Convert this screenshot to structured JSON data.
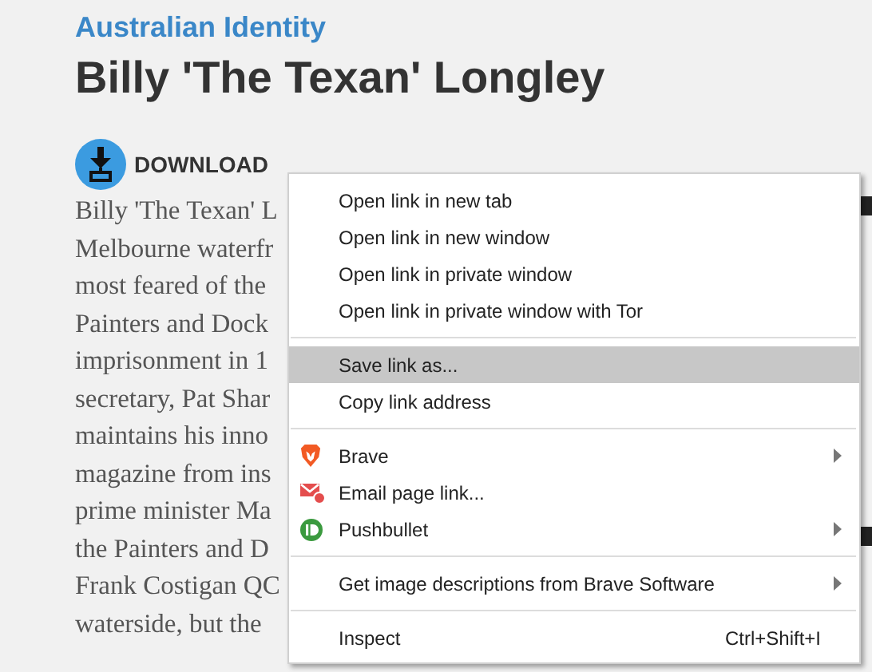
{
  "category": "Australian Identity",
  "title": "Billy 'The Texan' Longley",
  "download": {
    "label": "DOWNLOAD"
  },
  "article_lines": [
    "Billy 'The Texan' L",
    "Melbourne waterfr",
    "most feared of the",
    "Painters and Dock",
    "imprisonment in 1",
    "secretary, Pat Shar",
    "maintains his inno",
    "magazine from ins",
    "prime minister Ma",
    "the Painters and D",
    "Frank Costigan QC",
    "waterside, but the"
  ],
  "context_menu": [
    {
      "kind": "item",
      "label": "Open link in new tab",
      "submenu": false,
      "selected": false
    },
    {
      "kind": "item",
      "label": "Open link in new window",
      "submenu": false,
      "selected": false
    },
    {
      "kind": "item",
      "label": "Open link in private window",
      "submenu": false,
      "selected": false
    },
    {
      "kind": "item",
      "label": "Open link in private window with Tor",
      "submenu": false,
      "selected": false
    },
    {
      "kind": "separator"
    },
    {
      "kind": "item",
      "label": "Save link as...",
      "submenu": false,
      "selected": true
    },
    {
      "kind": "item",
      "label": "Copy link address",
      "submenu": false,
      "selected": false
    },
    {
      "kind": "separator"
    },
    {
      "kind": "item",
      "label": "Brave",
      "submenu": true,
      "selected": false
    },
    {
      "kind": "item",
      "label": "Email page link...",
      "submenu": false,
      "selected": false
    },
    {
      "kind": "item",
      "label": "Pushbullet",
      "submenu": true,
      "selected": false
    },
    {
      "kind": "separator"
    },
    {
      "kind": "item",
      "label": "Get image descriptions from Brave Software",
      "submenu": true,
      "selected": false
    },
    {
      "kind": "separator"
    },
    {
      "kind": "item",
      "label": "Inspect",
      "shortcut": "Ctrl+Shift+I",
      "submenu": false,
      "selected": false
    }
  ]
}
